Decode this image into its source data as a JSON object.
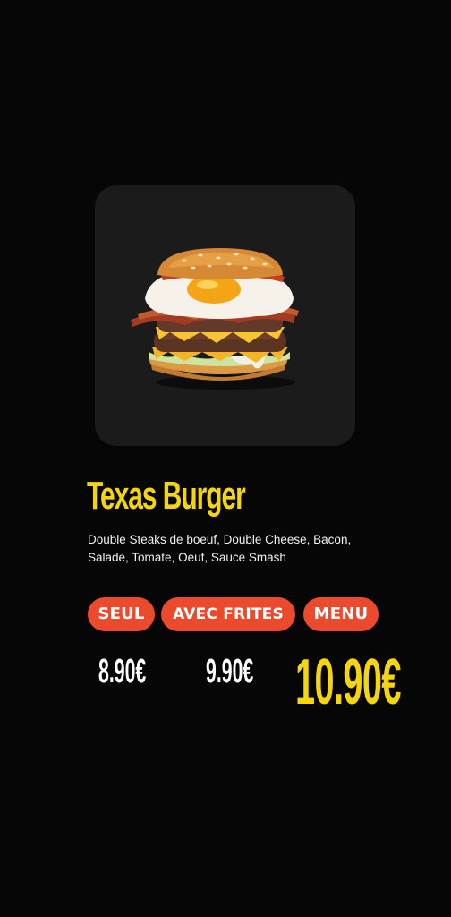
{
  "product": {
    "name": "Texas Burger",
    "description": "Double Steaks de boeuf, Double Cheese, Bacon, Salade, Tomate, Oeuf, Sauce Smash",
    "image_alt_icon": "burger-photo"
  },
  "options": [
    {
      "label": "SEUL",
      "price": "8.90€"
    },
    {
      "label": "AVEC FRITES",
      "price": "9.90€"
    },
    {
      "label": "MENU",
      "price": "10.90€"
    }
  ],
  "colors": {
    "background": "#060606",
    "card": "#1b1b1b",
    "accent_yellow": "#f5d60c",
    "pill_red": "#ec4a2c"
  }
}
